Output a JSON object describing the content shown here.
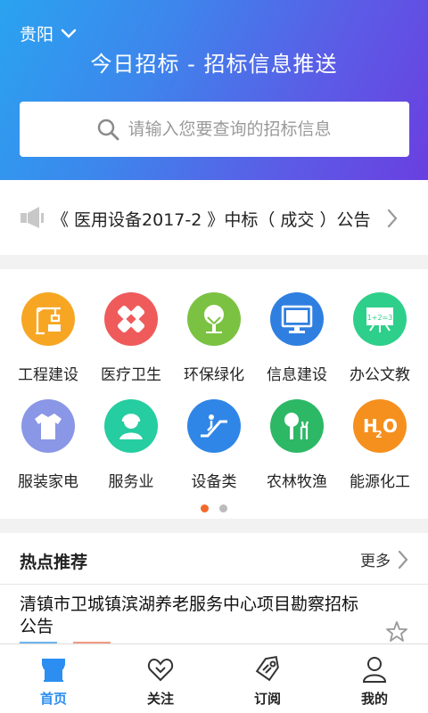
{
  "header": {
    "city": "贵阳",
    "title": "今日招标 - 招标信息推送",
    "search_placeholder": "请输入您要查询的招标信息"
  },
  "notice": {
    "text": "《 医用设备2017-2 》中标（ 成交 ）公告"
  },
  "categories": [
    {
      "label": "工程建设",
      "icon": "crane-icon",
      "color": "#f7a623"
    },
    {
      "label": "医疗卫生",
      "icon": "medical-cross-icon",
      "color": "#ef5b5b"
    },
    {
      "label": "环保绿化",
      "icon": "tree-icon",
      "color": "#7cc242"
    },
    {
      "label": "信息建设",
      "icon": "monitor-icon",
      "color": "#2f7fe0"
    },
    {
      "label": "办公文教",
      "icon": "blackboard-icon",
      "color": "#2ecf8a"
    },
    {
      "label": "服装家电",
      "icon": "shirt-icon",
      "color": "#8a97e6"
    },
    {
      "label": "服务业",
      "icon": "service-person-icon",
      "color": "#25cda0"
    },
    {
      "label": "设备类",
      "icon": "escalator-icon",
      "color": "#2f86e6"
    },
    {
      "label": "农林牧渔",
      "icon": "tree-deer-icon",
      "color": "#2db866"
    },
    {
      "label": "能源化工",
      "icon": "h2o-icon",
      "color": "#f5901e"
    }
  ],
  "pager": {
    "active": 0,
    "count": 2,
    "active_color": "#f26a2a",
    "inactive_color": "#bbbbbb"
  },
  "hot": {
    "title": "热点推荐",
    "more": "更多",
    "item_title": "清镇市卫城镇滨湖养老服务中心项目勘察招标公告"
  },
  "tabs": [
    {
      "label": "首页",
      "icon": "home-store-icon",
      "active": true
    },
    {
      "label": "关注",
      "icon": "heart-icon",
      "active": false
    },
    {
      "label": "订阅",
      "icon": "tag-icon",
      "active": false
    },
    {
      "label": "我的",
      "icon": "user-icon",
      "active": false
    }
  ],
  "colors": {
    "accent": "#2c8ef0"
  }
}
